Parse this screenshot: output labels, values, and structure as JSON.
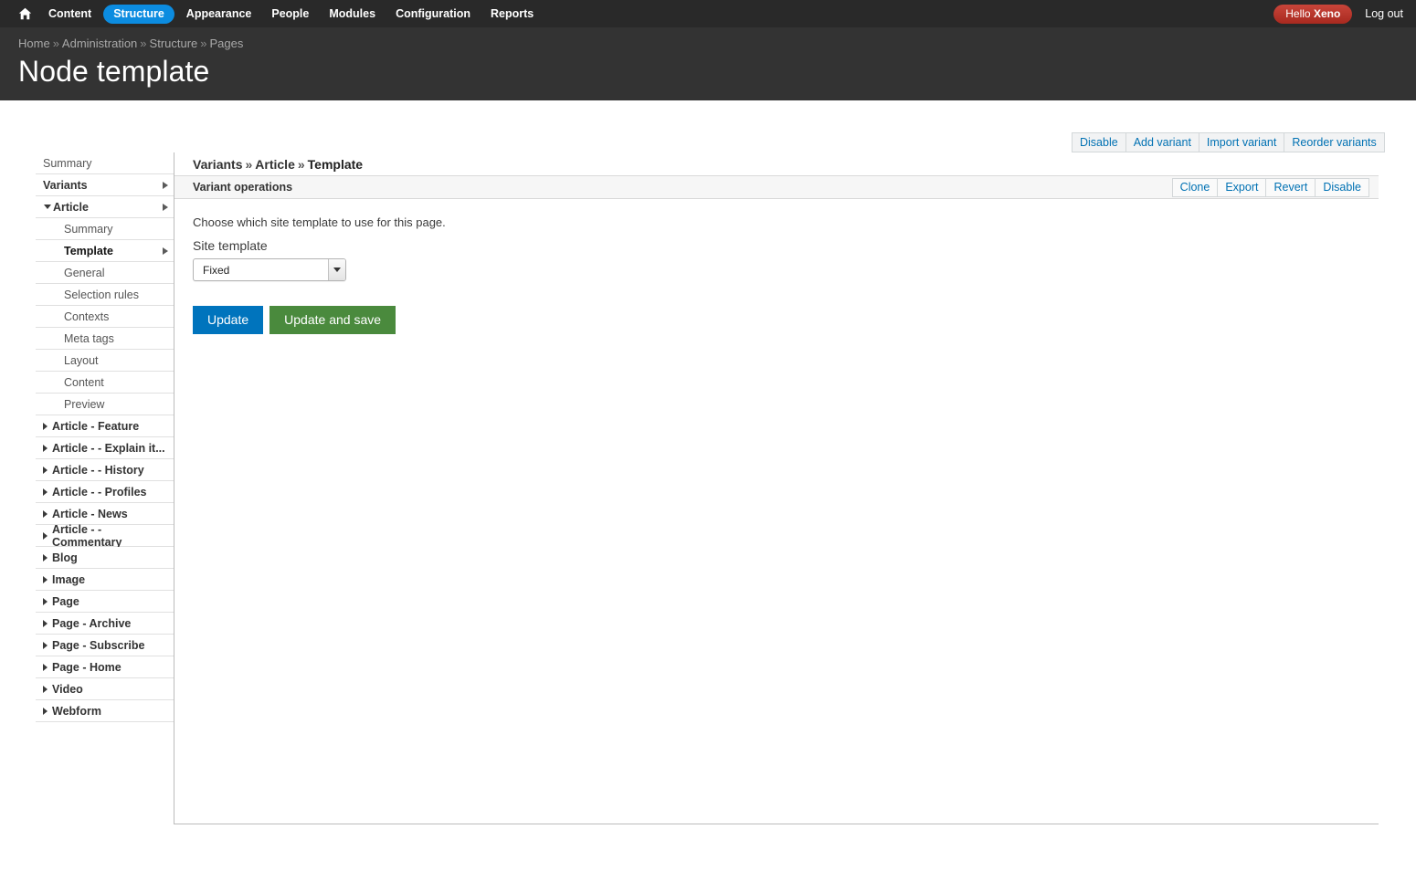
{
  "toolbar": {
    "home_icon": "home-icon",
    "items": [
      {
        "label": "Content",
        "active": false
      },
      {
        "label": "Structure",
        "active": true
      },
      {
        "label": "Appearance",
        "active": false
      },
      {
        "label": "People",
        "active": false
      },
      {
        "label": "Modules",
        "active": false
      },
      {
        "label": "Configuration",
        "active": false
      },
      {
        "label": "Reports",
        "active": false
      }
    ],
    "greeting_prefix": "Hello ",
    "user_name": "Xeno",
    "logout_label": "Log out",
    "active_color": "#0c8ce0",
    "bar_color": "#292929",
    "user_pill_color": "#c0392b"
  },
  "breadcrumb": {
    "items": [
      "Home",
      "Administration",
      "Structure",
      "Pages"
    ],
    "separator": "»"
  },
  "page": {
    "title": "Node template",
    "header_bg": "#333333"
  },
  "local_actions": [
    {
      "label": "Disable"
    },
    {
      "label": "Add variant"
    },
    {
      "label": "Import variant"
    },
    {
      "label": "Reorder variants"
    }
  ],
  "content": {
    "crumb": {
      "part1": "Variants",
      "sep1": "»",
      "part2": "Article",
      "sep2": "»",
      "part3": "Template"
    },
    "operations_title": "Variant operations",
    "operations_links": [
      {
        "label": "Clone"
      },
      {
        "label": "Export"
      },
      {
        "label": "Revert"
      },
      {
        "label": "Disable"
      }
    ],
    "form": {
      "description": "Choose which site template to use for this page.",
      "field_label": "Site template",
      "select_value": "Fixed",
      "select_icon": "chevron-down-icon",
      "update_label": "Update",
      "update_save_label": "Update and save",
      "update_color": "#0074bd",
      "update_save_color": "#4a8a3d"
    }
  },
  "sidebar": {
    "summary_label": "Summary",
    "variants_label": "Variants",
    "article_label": "Article",
    "article_children": [
      {
        "label": "Summary",
        "selected": false
      },
      {
        "label": "Template",
        "selected": true
      },
      {
        "label": "General",
        "selected": false
      },
      {
        "label": "Selection rules",
        "selected": false
      },
      {
        "label": "Contexts",
        "selected": false
      },
      {
        "label": "Meta tags",
        "selected": false
      },
      {
        "label": "Layout",
        "selected": false
      },
      {
        "label": "Content",
        "selected": false
      },
      {
        "label": "Preview",
        "selected": false
      }
    ],
    "groups": [
      {
        "label": "Article - Feature"
      },
      {
        "label": "Article - - Explain it..."
      },
      {
        "label": "Article - - History"
      },
      {
        "label": "Article - - Profiles"
      },
      {
        "label": "Article - News"
      },
      {
        "label": "Article - - Commentary"
      },
      {
        "label": "Blog"
      },
      {
        "label": "Image"
      },
      {
        "label": "Page"
      },
      {
        "label": "Page - Archive"
      },
      {
        "label": "Page - Subscribe"
      },
      {
        "label": "Page - Home"
      },
      {
        "label": "Video"
      },
      {
        "label": "Webform"
      }
    ]
  }
}
